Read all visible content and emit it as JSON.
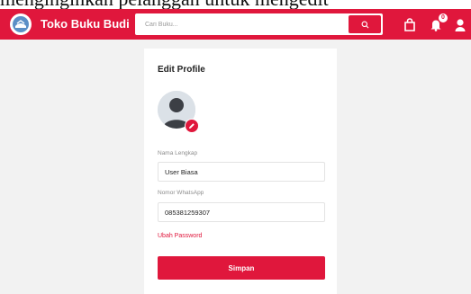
{
  "caption": {
    "text": "menginginkan pelanggan untuk mengedit"
  },
  "header": {
    "brand": "Toko Buku Budi",
    "search_placeholder": "Cari Buku...",
    "notification_count": "0",
    "colors": {
      "primary": "#e0173c"
    },
    "icons": [
      "logo-icon",
      "search-icon",
      "shopping-bag-icon",
      "notification-bell-icon",
      "user-icon"
    ]
  },
  "profile_form": {
    "title": "Edit Profile",
    "fullname_label": "Nama Lengkap",
    "fullname_value": "User Biasa",
    "whatsapp_label": "Nomor WhatsApp",
    "whatsapp_value": "085381259307",
    "change_password_link": "Ubah Password",
    "submit_label": "Simpan"
  }
}
